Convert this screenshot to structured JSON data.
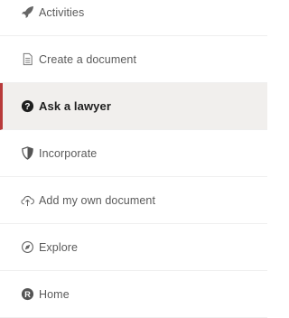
{
  "menu": {
    "items": [
      {
        "label": "Activities",
        "icon": "rocket-icon",
        "active": false
      },
      {
        "label": "Create a document",
        "icon": "document-icon",
        "active": false
      },
      {
        "label": "Ask a lawyer",
        "icon": "question-circle-icon",
        "active": true
      },
      {
        "label": "Incorporate",
        "icon": "shield-icon",
        "active": false
      },
      {
        "label": "Add my own document",
        "icon": "cloud-upload-icon",
        "active": false
      },
      {
        "label": "Explore",
        "icon": "compass-icon",
        "active": false
      },
      {
        "label": "Home",
        "icon": "brand-logo-icon",
        "active": false
      }
    ]
  },
  "colors": {
    "active_background": "#f1efed",
    "active_border": "#b83a3a",
    "text": "#5a5a5a",
    "active_text": "#1e1e1e"
  }
}
